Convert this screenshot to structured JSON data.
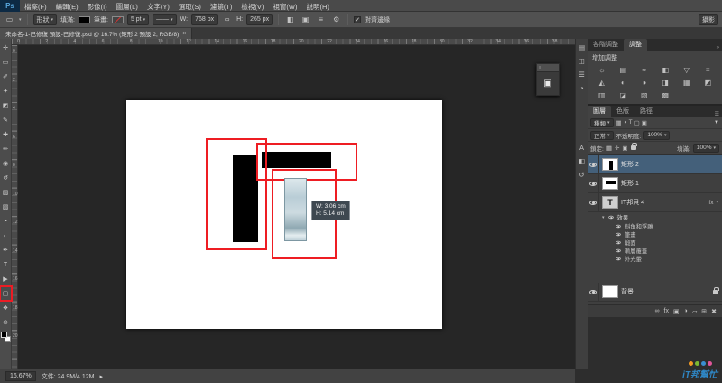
{
  "app": {
    "logo": "Ps",
    "workspace": "攝影"
  },
  "menu": {
    "items": [
      {
        "name": "menu-file",
        "label": "檔案(F)"
      },
      {
        "name": "menu-edit",
        "label": "編輯(E)"
      },
      {
        "name": "menu-image",
        "label": "影像(I)"
      },
      {
        "name": "menu-layer",
        "label": "圖層(L)"
      },
      {
        "name": "menu-type",
        "label": "文字(Y)"
      },
      {
        "name": "menu-select",
        "label": "選取(S)"
      },
      {
        "name": "menu-filter",
        "label": "濾鏡(T)"
      },
      {
        "name": "menu-view",
        "label": "檢視(V)"
      },
      {
        "name": "menu-window",
        "label": "視窗(W)"
      },
      {
        "name": "menu-help",
        "label": "說明(H)"
      }
    ]
  },
  "options": {
    "tool_mode": "形狀",
    "fill_label": "填滿:",
    "stroke_label": "筆畫:",
    "stroke_width": "5 pt",
    "w_label": "W:",
    "w_value": "768 px",
    "h_label": "H:",
    "h_value": "265 px",
    "align_edges_label": "對齊邊緣",
    "align_edges_checked": "✓"
  },
  "document": {
    "tab_title": "未命名-1-已修復 預設-已修復.psd @ 16.7% (矩形 2 預設 2, RGB/8)",
    "tab_close": "×",
    "zoom": "16.67%",
    "status": "文件: 24.9M/4.12M"
  },
  "tooltip": {
    "w": "W: 3.06 cm",
    "h": "H: 5.14 cm"
  },
  "rulers": {
    "horizontal": [
      0,
      2,
      4,
      6,
      8,
      10,
      12,
      14,
      16,
      18,
      20,
      22,
      24,
      26,
      28,
      30,
      32,
      34,
      36,
      38
    ],
    "vertical": [
      0,
      2,
      4,
      6,
      8,
      10,
      12,
      14,
      16,
      18,
      20
    ]
  },
  "toolbar": {
    "tools": [
      {
        "name": "move-tool",
        "glyph": "✛"
      },
      {
        "name": "rectangular-marquee-tool",
        "glyph": "▭"
      },
      {
        "name": "lasso-tool",
        "glyph": "✐"
      },
      {
        "name": "quick-selection-tool",
        "glyph": "✦"
      },
      {
        "name": "crop-tool",
        "glyph": "◩"
      },
      {
        "name": "eyedropper-tool",
        "glyph": "✎"
      },
      {
        "name": "spot-healing-brush-tool",
        "glyph": "✚"
      },
      {
        "name": "brush-tool",
        "glyph": "✏"
      },
      {
        "name": "clone-stamp-tool",
        "glyph": "◉"
      },
      {
        "name": "history-brush-tool",
        "glyph": "↺"
      },
      {
        "name": "eraser-tool",
        "glyph": "▨"
      },
      {
        "name": "gradient-tool",
        "glyph": "▧"
      },
      {
        "name": "blur-tool",
        "glyph": "◔"
      },
      {
        "name": "dodge-tool",
        "glyph": "◐"
      },
      {
        "name": "pen-tool",
        "glyph": "✒"
      },
      {
        "name": "type-tool",
        "glyph": "T"
      },
      {
        "name": "path-selection-tool",
        "glyph": "▶"
      },
      {
        "name": "rectangle-tool",
        "glyph": "▢",
        "highlighted": true
      },
      {
        "name": "hand-tool",
        "glyph": "❖"
      },
      {
        "name": "zoom-tool",
        "glyph": "⊕"
      }
    ]
  },
  "adjustments": {
    "tabs": [
      {
        "name": "tab-adjustments-left",
        "label": "各階調整",
        "active": false
      },
      {
        "name": "tab-adjustments",
        "label": "調整",
        "active": true
      }
    ],
    "collapse": "»",
    "header": "增加調整",
    "icons": [
      {
        "name": "brightness-contrast-icon",
        "glyph": "☼"
      },
      {
        "name": "levels-icon",
        "glyph": "▤"
      },
      {
        "name": "curves-icon",
        "glyph": "≈"
      },
      {
        "name": "exposure-icon",
        "glyph": "◧"
      },
      {
        "name": "vibrance-icon",
        "glyph": "▽"
      },
      {
        "name": "hue-saturation-icon",
        "glyph": "≡"
      },
      {
        "name": "color-balance-icon",
        "glyph": "◭"
      },
      {
        "name": "black-white-icon",
        "glyph": "◐"
      },
      {
        "name": "photo-filter-icon",
        "glyph": "◑"
      },
      {
        "name": "channel-mixer-icon",
        "glyph": "◨"
      },
      {
        "name": "color-lookup-icon",
        "glyph": "▦"
      },
      {
        "name": "invert-icon",
        "glyph": "◩"
      },
      {
        "name": "posterize-icon",
        "glyph": "▥"
      },
      {
        "name": "threshold-icon",
        "glyph": "◪"
      },
      {
        "name": "selective-color-icon",
        "glyph": "▧"
      },
      {
        "name": "gradient-map-icon",
        "glyph": "▩"
      }
    ]
  },
  "dock_strip": {
    "top": [
      {
        "name": "collapsed-properties-panel-icon",
        "glyph": "▤"
      },
      {
        "name": "collapsed-info-panel-icon",
        "glyph": "◫"
      },
      {
        "name": "collapsed-histogram-panel-icon",
        "glyph": "☰"
      },
      {
        "name": "collapsed-color-panel-icon",
        "glyph": "◔"
      }
    ],
    "middle": [
      {
        "name": "collapsed-character-panel-icon",
        "glyph": "A"
      },
      {
        "name": "collapsed-paragraph-panel-icon",
        "glyph": "◧"
      },
      {
        "name": "collapsed-history-panel-icon",
        "glyph": "↺"
      }
    ]
  },
  "layers_panel": {
    "tabs": [
      {
        "name": "tab-layers",
        "label": "圖層",
        "active": true
      },
      {
        "name": "tab-channels",
        "label": "色版",
        "active": false
      },
      {
        "name": "tab-paths",
        "label": "路徑",
        "active": false
      }
    ],
    "panel_menu": "☰",
    "filter_label": "種類",
    "filter_icons": [
      {
        "name": "filter-pixel-icon",
        "glyph": "▦"
      },
      {
        "name": "filter-adjustment-icon",
        "glyph": "◑"
      },
      {
        "name": "filter-type-icon",
        "glyph": "T"
      },
      {
        "name": "filter-shape-icon",
        "glyph": "▢"
      },
      {
        "name": "filter-smart-object-icon",
        "glyph": "▣"
      }
    ],
    "funnel": "▼",
    "blend_mode": "正常",
    "opacity_label": "不透明度:",
    "opacity_value": "100%",
    "lock_label": "鎖定:",
    "lock_icons": [
      {
        "name": "lock-transparent-icon",
        "glyph": "▦"
      },
      {
        "name": "lock-position-icon",
        "glyph": "✛"
      },
      {
        "name": "lock-image-icon",
        "glyph": "▣"
      }
    ],
    "fill_label": "填滿:",
    "fill_value": "100%",
    "layers": [
      {
        "kind": "shape",
        "name": "矩形 2",
        "selected": true,
        "thumb": "vbar"
      },
      {
        "kind": "shape",
        "name": "矩形 1",
        "selected": false,
        "thumb": "hbar"
      },
      {
        "kind": "text",
        "name": "IT邦貝 4",
        "has_fx": true,
        "fx_badge": "fx"
      },
      {
        "kind": "effects",
        "name": "效果",
        "children": [
          "斜角和浮雕",
          "筆畫",
          "緞面",
          "漸層覆蓋",
          "外光暈"
        ]
      },
      {
        "kind": "background",
        "name": "背景",
        "locked": true
      }
    ],
    "bottom_icons": [
      {
        "name": "link-layers-icon",
        "glyph": "∞"
      },
      {
        "name": "layer-style-icon",
        "glyph": "fx"
      },
      {
        "name": "layer-mask-icon",
        "glyph": "▣"
      },
      {
        "name": "adjustment-layer-icon",
        "glyph": "◑"
      },
      {
        "name": "new-group-icon",
        "glyph": "▱"
      },
      {
        "name": "new-layer-icon",
        "glyph": "⊞"
      },
      {
        "name": "delete-layer-icon",
        "glyph": "✖"
      }
    ]
  },
  "watermark": {
    "text": "iT邦幫忙",
    "dot_colors": [
      "#f59b22",
      "#7cb832",
      "#3a8fd0",
      "#e0559a"
    ]
  },
  "colors": {
    "annotation_red": "#ee1d23",
    "selected_layer": "#44607a"
  }
}
